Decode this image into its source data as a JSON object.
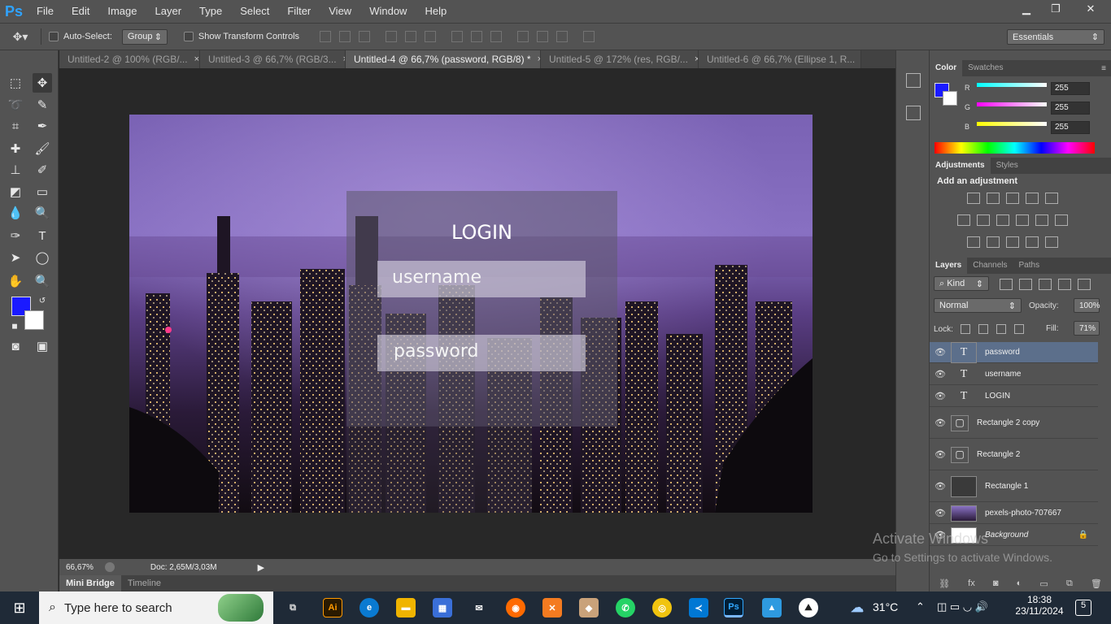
{
  "app": {
    "logo": "Ps"
  },
  "menu": [
    "File",
    "Edit",
    "Image",
    "Layer",
    "Type",
    "Select",
    "Filter",
    "View",
    "Window",
    "Help"
  ],
  "window_controls": {
    "minimize": "▁",
    "restore": "❐",
    "close": "✕"
  },
  "options": {
    "auto_select_label": "Auto-Select:",
    "auto_select_value": "Group",
    "transform_label": "Show Transform Controls",
    "workspace": "Essentials"
  },
  "tabs": [
    {
      "label": "Untitled-2 @ 100% (RGB/...",
      "close": "×"
    },
    {
      "label": "Untitled-3 @ 66,7% (RGB/3...",
      "close": "×"
    },
    {
      "label": "Untitled-4 @ 66,7% (password, RGB/8) *",
      "close": "×"
    },
    {
      "label": "Untitled-5 @ 172% (res, RGB/...",
      "close": "×"
    },
    {
      "label": "Untitled-6 @ 66,7% (Ellipse 1, R...",
      "close": "×"
    }
  ],
  "canvas": {
    "login_title": "LOGIN",
    "username_placeholder": "username",
    "password_placeholder": "password"
  },
  "status": {
    "zoom": "66,67%",
    "doc": "Doc: 2,65M/3,03M"
  },
  "bottom_tabs": [
    "Mini Bridge",
    "Timeline"
  ],
  "color_panel": {
    "tabs": [
      "Color",
      "Swatches"
    ],
    "r_label": "R",
    "g_label": "G",
    "b_label": "B",
    "r": "255",
    "g": "255",
    "b": "255",
    "foreground": "#1a1aff",
    "background": "#ffffff"
  },
  "adjustments": {
    "tabs": [
      "Adjustments",
      "Styles"
    ],
    "heading": "Add an adjustment"
  },
  "layers_panel": {
    "tabs": [
      "Layers",
      "Channels",
      "Paths"
    ],
    "kind": "Kind",
    "blend_mode": "Normal",
    "opacity_label": "Opacity:",
    "opacity": "100%",
    "lock_label": "Lock:",
    "fill_label": "Fill:",
    "fill": "71%",
    "layers": [
      {
        "name": "password",
        "type": "T"
      },
      {
        "name": "username",
        "type": "T"
      },
      {
        "name": "LOGIN",
        "type": "T"
      },
      {
        "name": "Rectangle 2 copy",
        "type": "shape"
      },
      {
        "name": "Rectangle 2",
        "type": "shape"
      },
      {
        "name": "Rectangle 1",
        "type": "shape"
      },
      {
        "name": "pexels-photo-707667",
        "type": "image"
      },
      {
        "name": "Background",
        "type": "bg"
      }
    ]
  },
  "watermark": {
    "line1": "Activate Windows",
    "line2": "Go to Settings to activate Windows."
  },
  "taskbar": {
    "search_placeholder": "Type here to search",
    "weather": "31°C",
    "time": "18:38",
    "date": "23/11/2024",
    "notifications": "5"
  }
}
